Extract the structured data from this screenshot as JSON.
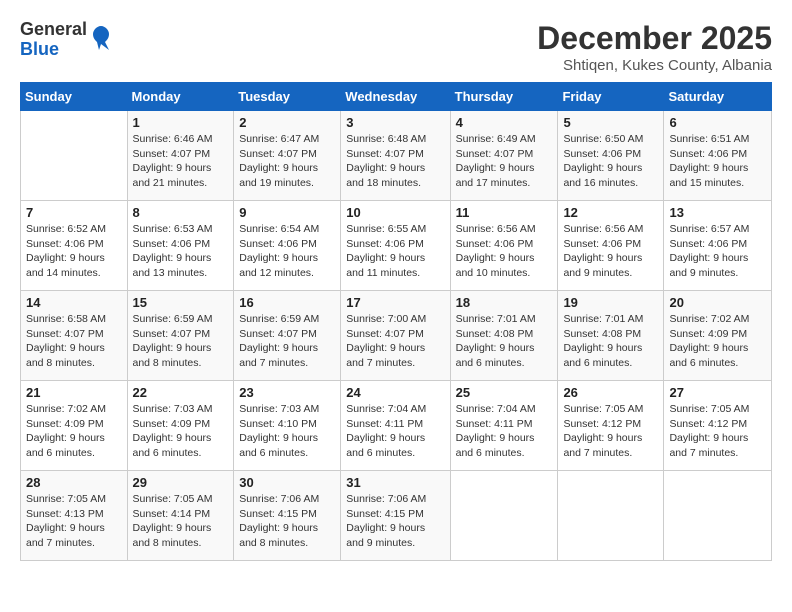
{
  "logo": {
    "general": "General",
    "blue": "Blue"
  },
  "title": "December 2025",
  "subtitle": "Shtiqen, Kukes County, Albania",
  "days_of_week": [
    "Sunday",
    "Monday",
    "Tuesday",
    "Wednesday",
    "Thursday",
    "Friday",
    "Saturday"
  ],
  "weeks": [
    [
      {
        "day": "",
        "info": ""
      },
      {
        "day": "1",
        "info": "Sunrise: 6:46 AM\nSunset: 4:07 PM\nDaylight: 9 hours\nand 21 minutes."
      },
      {
        "day": "2",
        "info": "Sunrise: 6:47 AM\nSunset: 4:07 PM\nDaylight: 9 hours\nand 19 minutes."
      },
      {
        "day": "3",
        "info": "Sunrise: 6:48 AM\nSunset: 4:07 PM\nDaylight: 9 hours\nand 18 minutes."
      },
      {
        "day": "4",
        "info": "Sunrise: 6:49 AM\nSunset: 4:07 PM\nDaylight: 9 hours\nand 17 minutes."
      },
      {
        "day": "5",
        "info": "Sunrise: 6:50 AM\nSunset: 4:06 PM\nDaylight: 9 hours\nand 16 minutes."
      },
      {
        "day": "6",
        "info": "Sunrise: 6:51 AM\nSunset: 4:06 PM\nDaylight: 9 hours\nand 15 minutes."
      }
    ],
    [
      {
        "day": "7",
        "info": "Sunrise: 6:52 AM\nSunset: 4:06 PM\nDaylight: 9 hours\nand 14 minutes."
      },
      {
        "day": "8",
        "info": "Sunrise: 6:53 AM\nSunset: 4:06 PM\nDaylight: 9 hours\nand 13 minutes."
      },
      {
        "day": "9",
        "info": "Sunrise: 6:54 AM\nSunset: 4:06 PM\nDaylight: 9 hours\nand 12 minutes."
      },
      {
        "day": "10",
        "info": "Sunrise: 6:55 AM\nSunset: 4:06 PM\nDaylight: 9 hours\nand 11 minutes."
      },
      {
        "day": "11",
        "info": "Sunrise: 6:56 AM\nSunset: 4:06 PM\nDaylight: 9 hours\nand 10 minutes."
      },
      {
        "day": "12",
        "info": "Sunrise: 6:56 AM\nSunset: 4:06 PM\nDaylight: 9 hours\nand 9 minutes."
      },
      {
        "day": "13",
        "info": "Sunrise: 6:57 AM\nSunset: 4:06 PM\nDaylight: 9 hours\nand 9 minutes."
      }
    ],
    [
      {
        "day": "14",
        "info": "Sunrise: 6:58 AM\nSunset: 4:07 PM\nDaylight: 9 hours\nand 8 minutes."
      },
      {
        "day": "15",
        "info": "Sunrise: 6:59 AM\nSunset: 4:07 PM\nDaylight: 9 hours\nand 8 minutes."
      },
      {
        "day": "16",
        "info": "Sunrise: 6:59 AM\nSunset: 4:07 PM\nDaylight: 9 hours\nand 7 minutes."
      },
      {
        "day": "17",
        "info": "Sunrise: 7:00 AM\nSunset: 4:07 PM\nDaylight: 9 hours\nand 7 minutes."
      },
      {
        "day": "18",
        "info": "Sunrise: 7:01 AM\nSunset: 4:08 PM\nDaylight: 9 hours\nand 6 minutes."
      },
      {
        "day": "19",
        "info": "Sunrise: 7:01 AM\nSunset: 4:08 PM\nDaylight: 9 hours\nand 6 minutes."
      },
      {
        "day": "20",
        "info": "Sunrise: 7:02 AM\nSunset: 4:09 PM\nDaylight: 9 hours\nand 6 minutes."
      }
    ],
    [
      {
        "day": "21",
        "info": "Sunrise: 7:02 AM\nSunset: 4:09 PM\nDaylight: 9 hours\nand 6 minutes."
      },
      {
        "day": "22",
        "info": "Sunrise: 7:03 AM\nSunset: 4:09 PM\nDaylight: 9 hours\nand 6 minutes."
      },
      {
        "day": "23",
        "info": "Sunrise: 7:03 AM\nSunset: 4:10 PM\nDaylight: 9 hours\nand 6 minutes."
      },
      {
        "day": "24",
        "info": "Sunrise: 7:04 AM\nSunset: 4:11 PM\nDaylight: 9 hours\nand 6 minutes."
      },
      {
        "day": "25",
        "info": "Sunrise: 7:04 AM\nSunset: 4:11 PM\nDaylight: 9 hours\nand 6 minutes."
      },
      {
        "day": "26",
        "info": "Sunrise: 7:05 AM\nSunset: 4:12 PM\nDaylight: 9 hours\nand 7 minutes."
      },
      {
        "day": "27",
        "info": "Sunrise: 7:05 AM\nSunset: 4:12 PM\nDaylight: 9 hours\nand 7 minutes."
      }
    ],
    [
      {
        "day": "28",
        "info": "Sunrise: 7:05 AM\nSunset: 4:13 PM\nDaylight: 9 hours\nand 7 minutes."
      },
      {
        "day": "29",
        "info": "Sunrise: 7:05 AM\nSunset: 4:14 PM\nDaylight: 9 hours\nand 8 minutes."
      },
      {
        "day": "30",
        "info": "Sunrise: 7:06 AM\nSunset: 4:15 PM\nDaylight: 9 hours\nand 8 minutes."
      },
      {
        "day": "31",
        "info": "Sunrise: 7:06 AM\nSunset: 4:15 PM\nDaylight: 9 hours\nand 9 minutes."
      },
      {
        "day": "",
        "info": ""
      },
      {
        "day": "",
        "info": ""
      },
      {
        "day": "",
        "info": ""
      }
    ]
  ]
}
